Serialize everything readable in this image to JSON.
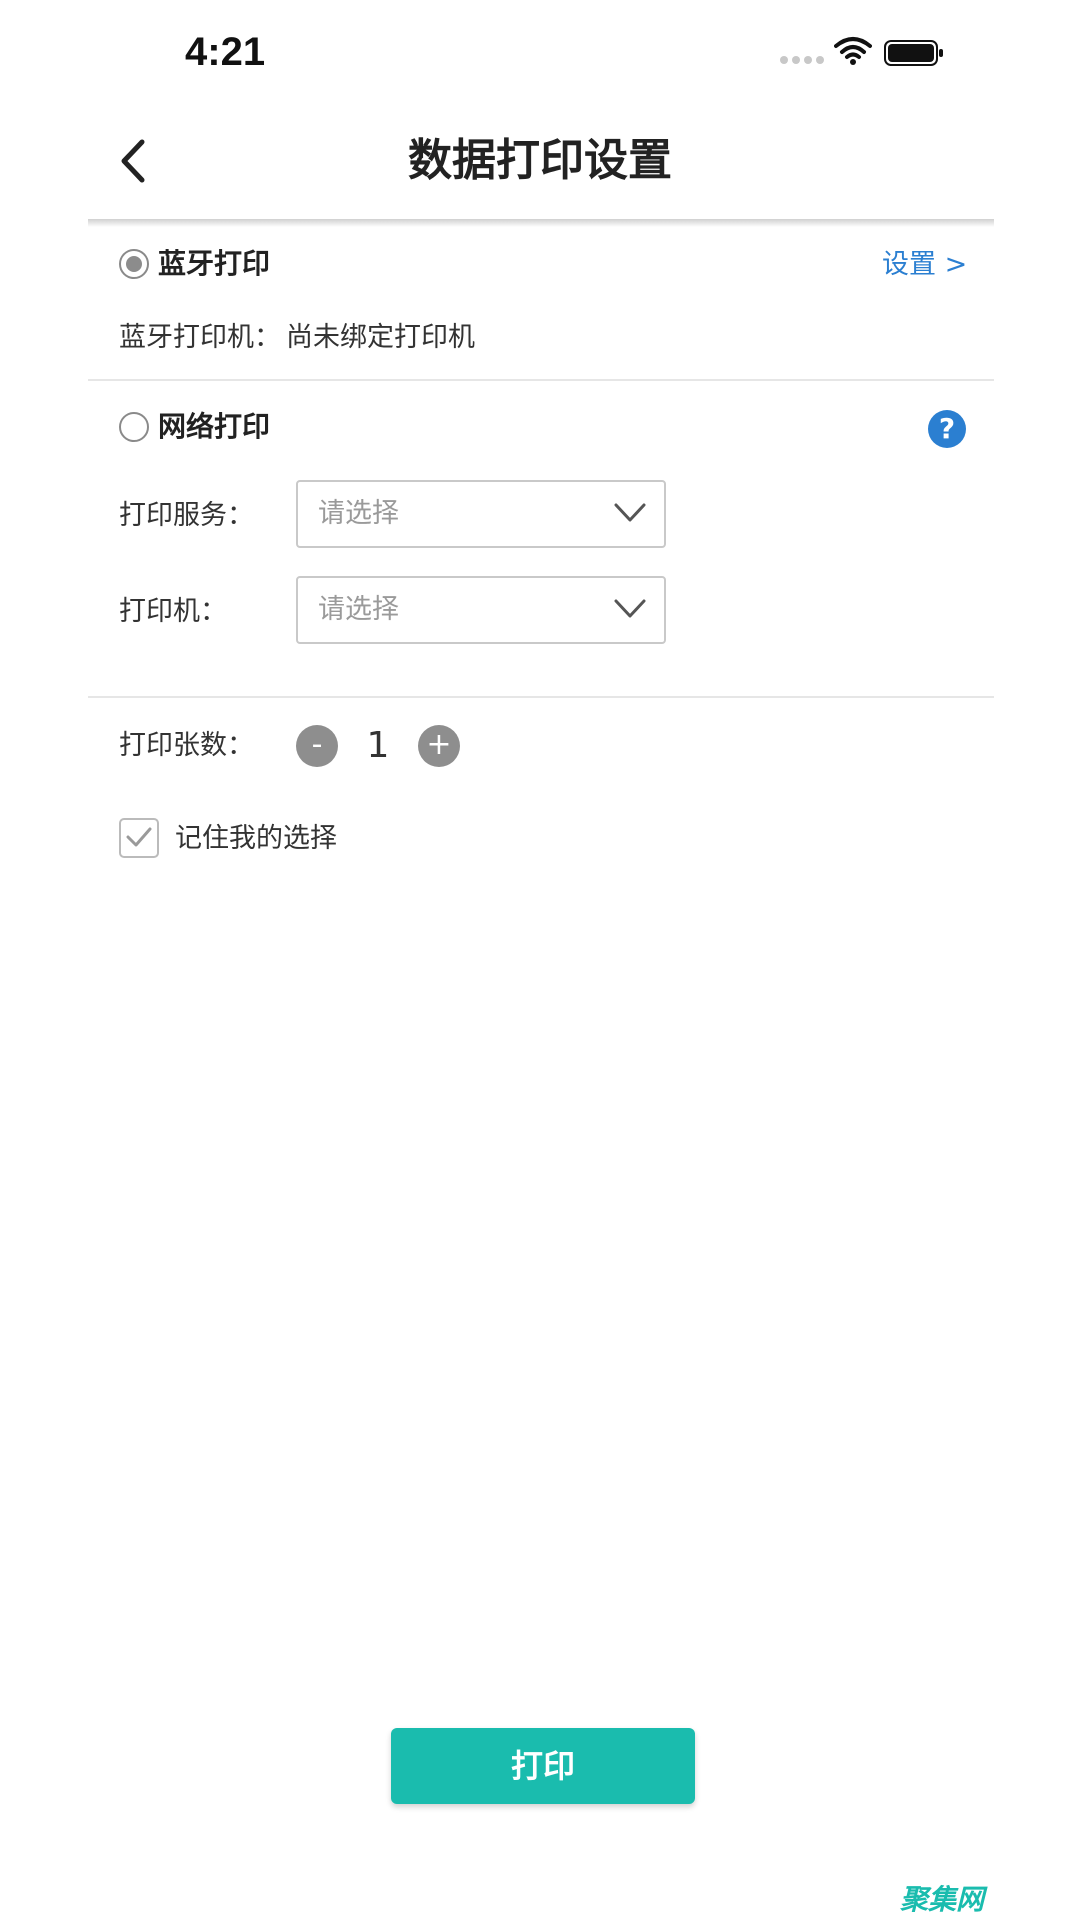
{
  "status_bar": {
    "time": "4:21"
  },
  "header": {
    "title": "数据打印设置",
    "back_icon": "chevron-left-icon"
  },
  "bluetooth": {
    "label": "蓝牙打印",
    "selected": true,
    "settings_link": "设置 >",
    "printer_label": "蓝牙打印机：",
    "printer_value": "尚未绑定打印机"
  },
  "network": {
    "label": "网络打印",
    "selected": false,
    "help_icon": "question-circle-icon",
    "help_glyph": "?",
    "service_label": "打印服务：",
    "service_placeholder": "请选择",
    "printer_label": "打印机：",
    "printer_placeholder": "请选择"
  },
  "copies": {
    "label": "打印张数：",
    "minus": "-",
    "value": "1",
    "plus": "+"
  },
  "remember": {
    "label": "记住我的选择",
    "checked": true
  },
  "print_button": {
    "label": "打印"
  },
  "watermark": {
    "text": "聚集网"
  },
  "colors": {
    "accent": "#1abcae",
    "link": "#2b7fd1",
    "radio_dot": "#8c8c8c"
  }
}
